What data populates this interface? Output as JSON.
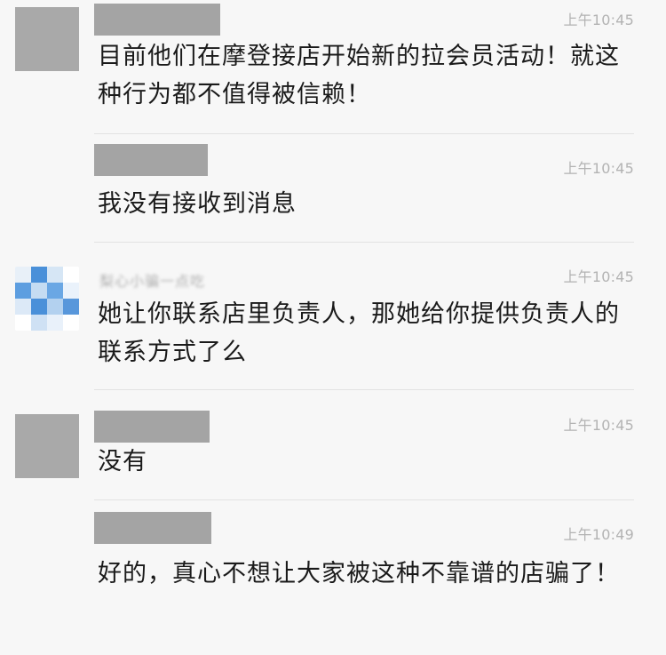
{
  "messages": [
    {
      "time": "上午10:45",
      "text": "目前他们在摩登接店开始新的拉会员活动！就这种行为都不值得被信赖！"
    },
    {
      "time": "上午10:45",
      "text": "我没有接收到消息"
    },
    {
      "time": "上午10:45",
      "sender_blurred": "梨心小骗一点吃",
      "text": "她让你联系店里负责人，那她给你提供负责人的联系方式了么"
    },
    {
      "time": "上午10:45",
      "text": "没有"
    },
    {
      "time": "上午10:49",
      "text": "好的，真心不想让大家被这种不靠谱的店骗了！"
    }
  ],
  "colors": {
    "background": "#f7f7f7",
    "redaction": "#a4a4a4",
    "timestamp": "#b3b3b3",
    "text": "#1a1a1a",
    "avatar_blue": "#4a90d9"
  }
}
